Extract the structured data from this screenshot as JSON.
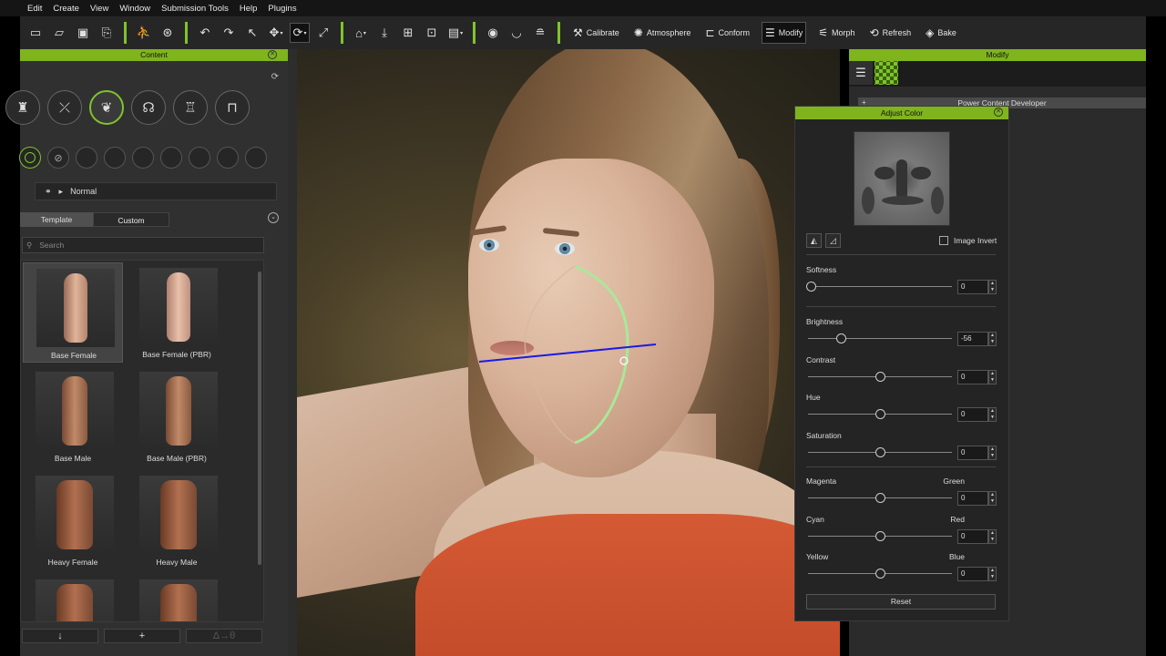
{
  "menu": [
    "Edit",
    "Create",
    "View",
    "Window",
    "Submission Tools",
    "Help",
    "Plugins"
  ],
  "toolbar": {
    "calibrate": "Calibrate",
    "atmosphere": "Atmosphere",
    "conform": "Conform",
    "modify": "Modify",
    "morph": "Morph",
    "refresh": "Refresh",
    "bake": "Bake"
  },
  "content": {
    "title": "Content",
    "shader": "Normal",
    "tabs": [
      "Template",
      "Custom"
    ],
    "search_placeholder": "Search",
    "items": [
      {
        "label": "Base Female"
      },
      {
        "label": "Base Female (PBR)"
      },
      {
        "label": "Base Male"
      },
      {
        "label": "Base Male (PBR)"
      },
      {
        "label": "Heavy Female"
      },
      {
        "label": "Heavy Male"
      }
    ],
    "bottom_buttons": [
      "↓",
      "+",
      "Δ→θ"
    ]
  },
  "modify": {
    "title": "Modify",
    "section": "Power Content Developer"
  },
  "adjust_color": {
    "title": "Adjust Color",
    "image_invert": "Image Invert",
    "reset": "Reset",
    "sliders": [
      {
        "label": "Softness",
        "right": "",
        "value": "0",
        "pos": 0.0
      },
      {
        "label": "Brightness",
        "right": "",
        "value": "-56",
        "pos": 0.22
      },
      {
        "label": "Contrast",
        "right": "",
        "value": "0",
        "pos": 0.5
      },
      {
        "label": "Hue",
        "right": "",
        "value": "0",
        "pos": 0.5
      },
      {
        "label": "Saturation",
        "right": "",
        "value": "0",
        "pos": 0.5
      },
      {
        "label": "Magenta",
        "right": "Green",
        "value": "0",
        "pos": 0.5
      },
      {
        "label": "Cyan",
        "right": "Red",
        "value": "0",
        "pos": 0.5
      },
      {
        "label": "Yellow",
        "right": "Blue",
        "value": "0",
        "pos": 0.5
      }
    ]
  },
  "colors": {
    "accent": "#7fb41d",
    "panel": "#2b2b2b"
  }
}
